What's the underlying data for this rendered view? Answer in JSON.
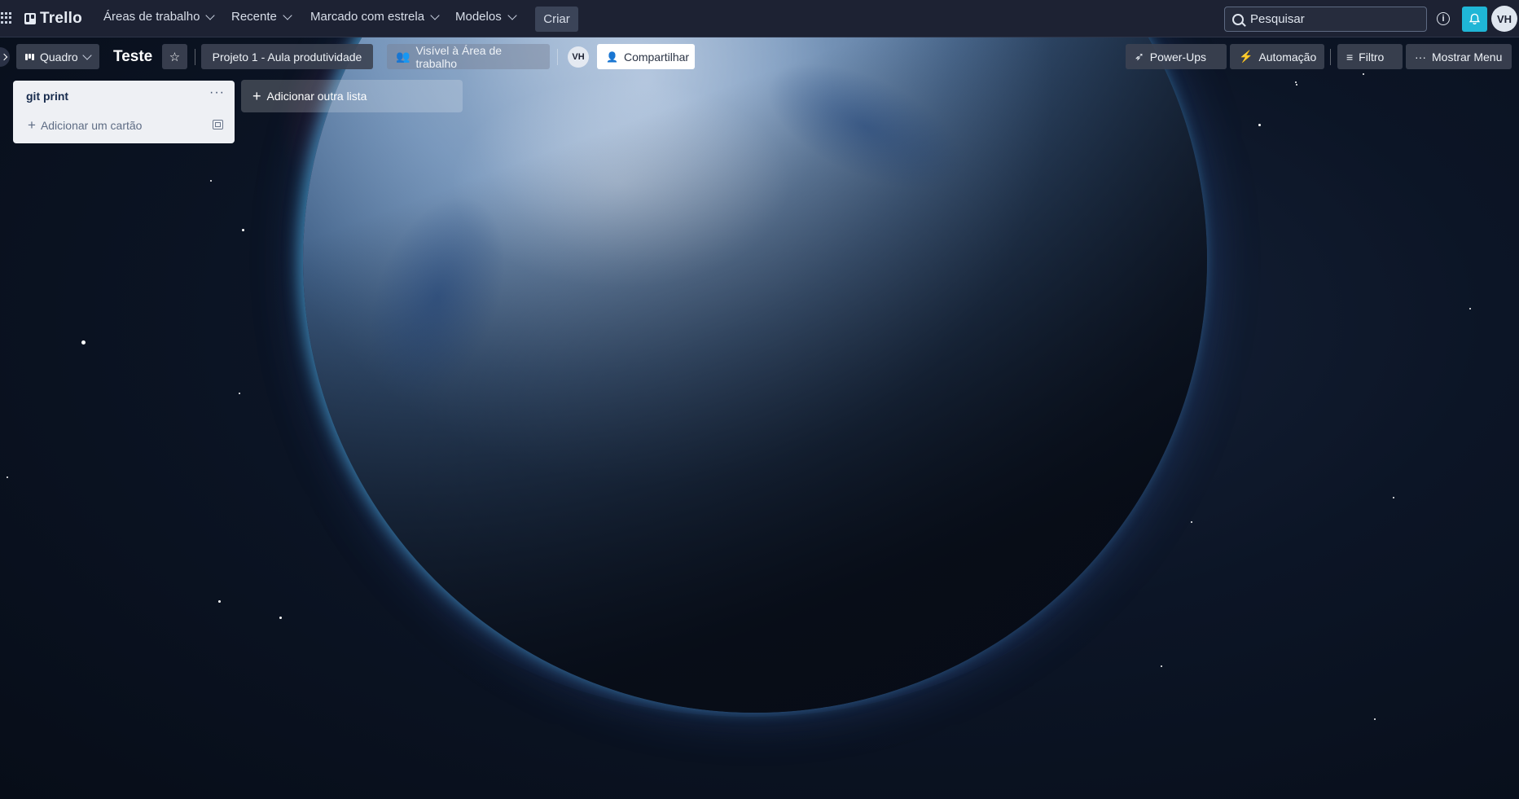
{
  "topbar": {
    "logo_text": "Trello",
    "nav": [
      {
        "label": "Áreas de trabalho"
      },
      {
        "label": "Recente"
      },
      {
        "label": "Marcado com estrela"
      },
      {
        "label": "Modelos"
      }
    ],
    "create_label": "Criar",
    "search_placeholder": "Pesquisar",
    "avatar_initials": "VH",
    "accent_color": "#1fb6d6"
  },
  "board_header": {
    "view_label": "Quadro",
    "title": "Teste",
    "workspace_label": "Projeto 1 - Aula produtividade",
    "visibility_label": "Visível à Área de trabalho",
    "member_initials": "VH",
    "share_label": "Compartilhar",
    "powerups_label": "Power-Ups",
    "automation_label": "Automação",
    "filter_label": "Filtro",
    "menu_label": "Mostrar Menu"
  },
  "lists": [
    {
      "title": "git print",
      "add_card_label": "Adicionar um cartão"
    }
  ],
  "add_list_label": "Adicionar outra lista"
}
